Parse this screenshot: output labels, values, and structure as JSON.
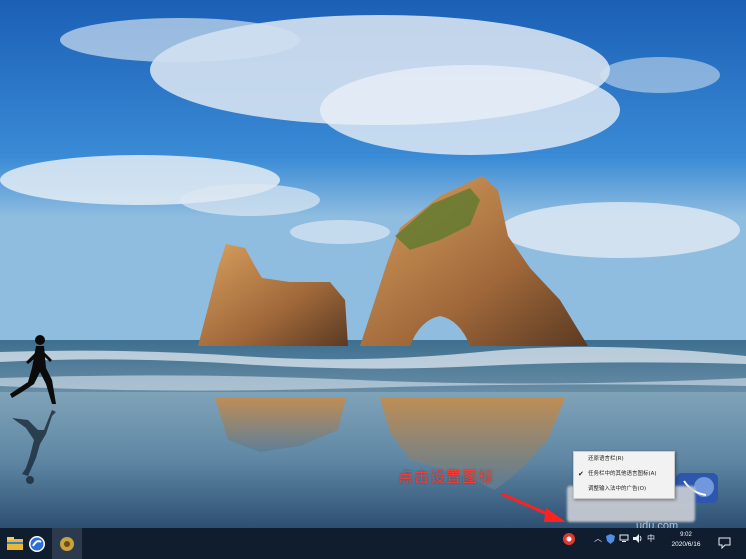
{
  "desktop": {
    "wallpaper": "coastal-rock-arch-beach",
    "annotation_text": "点击设置图标"
  },
  "context_menu": {
    "items": [
      {
        "label": "还原语言栏(R)",
        "checked": false
      },
      {
        "label": "任务栏中的其他语言图标(A)",
        "checked": true
      },
      {
        "label": "调整输入法中的广告(O)",
        "checked": false
      }
    ]
  },
  "watermark": "udu.com",
  "taskbar": {
    "pinned": [
      {
        "icon": "file-explorer-icon"
      },
      {
        "icon": "sogou-browser-icon"
      },
      {
        "icon": "app-icon"
      }
    ],
    "tray": {
      "icons": [
        "chevron-up-icon",
        "shield-icon",
        "network-icon",
        "volume-icon"
      ],
      "language": "中",
      "time": "9:02",
      "date": "2020/6/16"
    }
  },
  "colors": {
    "taskbar": "#0f1d2e",
    "annotation": "#ff3b30",
    "menu_bg": "#f2f2f2"
  }
}
